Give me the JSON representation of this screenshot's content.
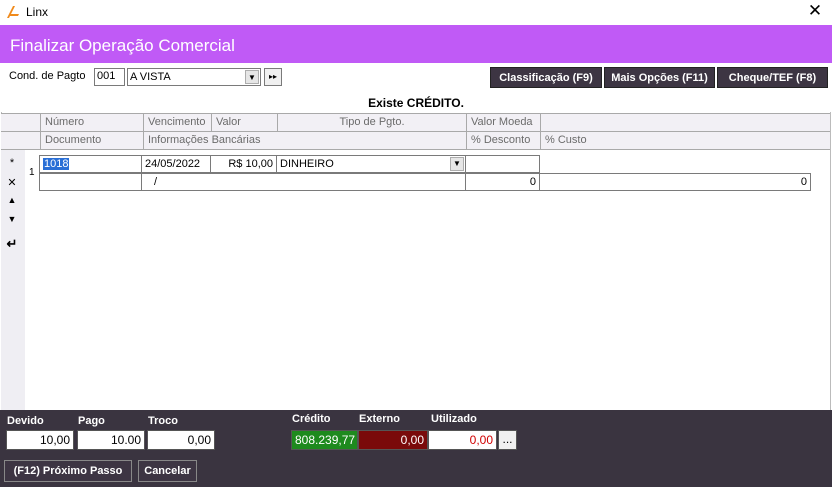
{
  "window": {
    "app_title": "Linx",
    "close_glyph": "✕"
  },
  "header": {
    "title": "Finalizar Operação Comercial"
  },
  "payment_condition": {
    "label": "Cond. de Pagto",
    "code": "001",
    "selected": "A VISTA",
    "dropdown_glyph": "▼",
    "next_glyph": "▸▸"
  },
  "actions": {
    "classificacao": "Classificação (F9)",
    "mais_opcoes": "Mais Opções (F11)",
    "cheque_tef": "Cheque/TEF (F8)"
  },
  "message": "Existe CRÉDITO.",
  "grid": {
    "headers_row1": [
      "Número",
      "Vencimento",
      "Valor",
      "Tipo de Pgto.",
      "Valor Moeda"
    ],
    "headers_row2": [
      "Documento",
      "Informações Bancárias",
      "% Desconto",
      "% Custo"
    ],
    "side_icons": [
      {
        "name": "add-icon",
        "glyph": "*"
      },
      {
        "name": "delete-icon",
        "glyph": "✕"
      },
      {
        "name": "move-up-icon",
        "glyph": "▲"
      },
      {
        "name": "move-down-icon",
        "glyph": "▼"
      },
      {
        "name": "enter-icon",
        "glyph": "↵"
      }
    ],
    "row": {
      "index": "1",
      "numero": "1018",
      "vencimento": "24/05/2022",
      "valor": "R$ 10,00",
      "tipo": "DINHEIRO",
      "tipo_dropdown_glyph": "▼",
      "valor_moeda": "",
      "documento": "",
      "info_bancarias": "/",
      "desconto": "0",
      "custo": "0"
    }
  },
  "footer": {
    "devido_label": "Devido",
    "devido_value": "10,00",
    "pago_label": "Pago",
    "pago_value": "10.00",
    "troco_label": "Troco",
    "troco_value": "0,00",
    "credito_label": "Crédito",
    "credito_value": "808.239,77",
    "externo_label": "Externo",
    "externo_value": "0,00",
    "utilizado_label": "Utilizado",
    "utilizado_value": "0,00",
    "more_label": "...",
    "proximo_passo": "(F12) Próximo Passo",
    "cancelar": "Cancelar"
  },
  "colors": {
    "header_bg": "#c05af6",
    "footer_bg": "#3a3440",
    "credito_bg": "#1e8a1e",
    "externo_bg": "#7a0a0a",
    "utilizado_text": "#d00000"
  }
}
